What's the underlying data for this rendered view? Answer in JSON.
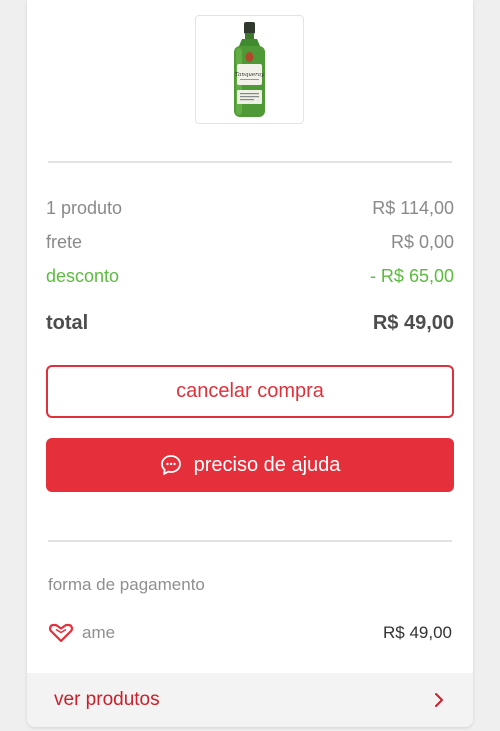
{
  "product": {
    "image_alt": "Tanqueray",
    "image_brand_text": "Tanqueray"
  },
  "summary": {
    "products_label": "1 produto",
    "products_value": "R$ 114,00",
    "shipping_label": "frete",
    "shipping_value": "R$ 0,00",
    "discount_label": "desconto",
    "discount_value": "- R$ 65,00",
    "total_label": "total",
    "total_value": "R$ 49,00"
  },
  "actions": {
    "cancel_label": "cancelar compra",
    "help_label": "preciso de ajuda",
    "help_icon": "chat-bubble-icon"
  },
  "payment": {
    "title": "forma de pagamento",
    "method_icon": "ame-heart-icon",
    "method_label": "ame",
    "method_amount": "R$ 49,00"
  },
  "footer": {
    "link_label": "ver produtos",
    "link_icon": "chevron-right-icon"
  },
  "colors": {
    "accent_red": "#e5303c",
    "discount_green": "#5dbb3f",
    "text_gray": "#8a8a8a",
    "background": "#efefef"
  }
}
